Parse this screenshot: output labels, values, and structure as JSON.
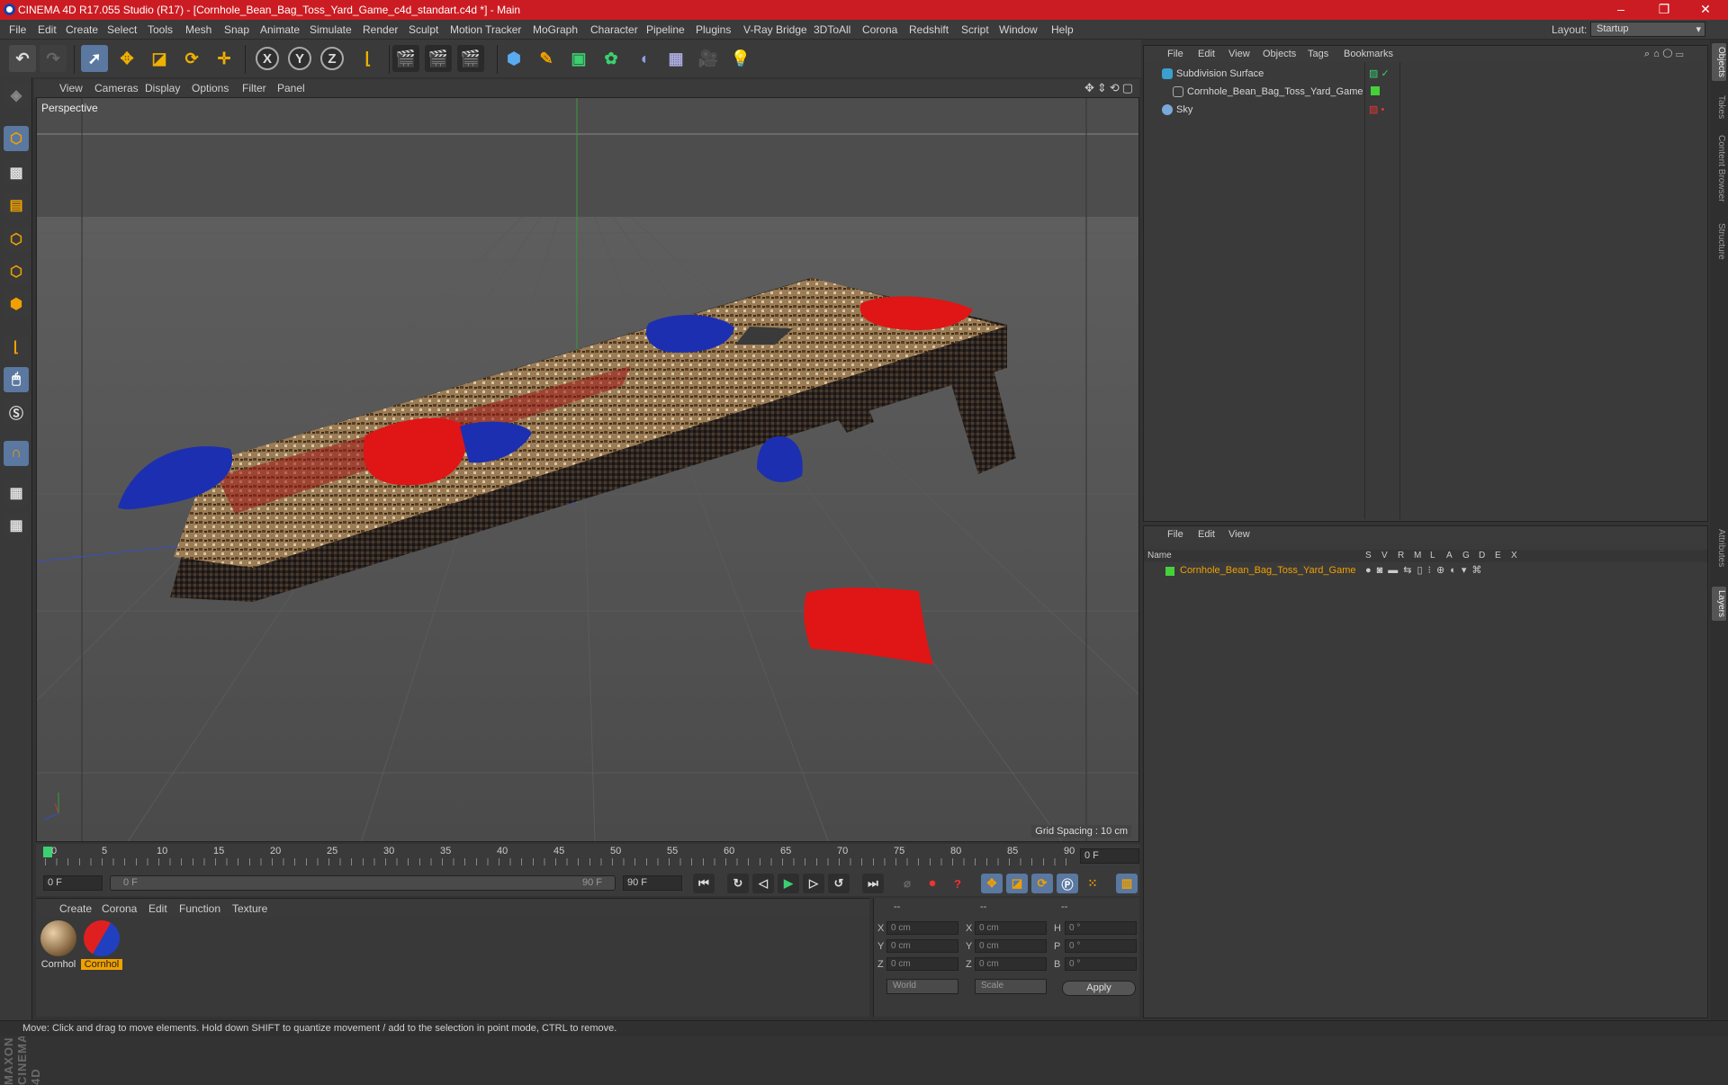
{
  "window": {
    "title": "CINEMA 4D R17.055 Studio (R17) - [Cornhole_Bean_Bag_Toss_Yard_Game_c4d_standart.c4d *] - Main",
    "minimize": "–",
    "maximize": "❐",
    "close": "✕"
  },
  "menu": [
    "File",
    "Edit",
    "Create",
    "Select",
    "Tools",
    "Mesh",
    "Snap",
    "Animate",
    "Simulate",
    "Render",
    "Sculpt",
    "Motion Tracker",
    "MoGraph",
    "Character",
    "Pipeline",
    "Plugins",
    "V-Ray Bridge",
    "3DToAll",
    "Corona",
    "Redshift",
    "Script",
    "Window",
    "Help"
  ],
  "layout": {
    "label": "Layout:",
    "value": "Startup"
  },
  "viewport": {
    "menu": [
      "View",
      "Cameras",
      "Display",
      "Options",
      "Filter",
      "Panel"
    ],
    "camera_label": "Perspective",
    "grid_spacing": "Grid Spacing : 10 cm"
  },
  "timeline": {
    "ticks": [
      "0",
      "5",
      "10",
      "15",
      "20",
      "25",
      "30",
      "35",
      "40",
      "45",
      "50",
      "55",
      "60",
      "65",
      "70",
      "75",
      "80",
      "85",
      "90"
    ],
    "current_frame": "0 F",
    "start_field": "0 F",
    "range_start": "0 F",
    "range_end": "90 F",
    "end_field": "90 F"
  },
  "materials": {
    "menu": [
      "Create",
      "Corona",
      "Edit",
      "Function",
      "Texture"
    ],
    "items": [
      {
        "label": "Cornhol",
        "selected": false
      },
      {
        "label": "Cornhol",
        "selected": true
      }
    ]
  },
  "coords": {
    "header": [
      "--",
      "--",
      "--"
    ],
    "rows": [
      {
        "a": "X",
        "av": "0 cm",
        "b": "X",
        "bv": "0 cm",
        "c": "H",
        "cv": "0 °"
      },
      {
        "a": "Y",
        "av": "0 cm",
        "b": "Y",
        "bv": "0 cm",
        "c": "P",
        "cv": "0 °"
      },
      {
        "a": "Z",
        "av": "0 cm",
        "b": "Z",
        "bv": "0 cm",
        "c": "B",
        "cv": "0 °"
      }
    ],
    "mode1": "World",
    "mode2": "Scale",
    "apply": "Apply"
  },
  "objects": {
    "menu": [
      "File",
      "Edit",
      "View",
      "Objects",
      "Tags",
      "Bookmarks"
    ],
    "items": [
      {
        "name": "Subdivision Surface",
        "color": "#3aa0d0"
      },
      {
        "name": "Cornhole_Bean_Bag_Toss_Yard_Game",
        "color": "#cccccc"
      },
      {
        "name": "Sky",
        "color": "#7aa8d8"
      }
    ]
  },
  "layers": {
    "menu": [
      "File",
      "Edit",
      "View"
    ],
    "columns": [
      "Name",
      "S",
      "V",
      "R",
      "M",
      "L",
      "A",
      "G",
      "D",
      "E",
      "X"
    ],
    "row": {
      "name": "Cornhole_Bean_Bag_Toss_Yard_Game",
      "color": "#44d13a"
    }
  },
  "right_tabs": [
    "Objects",
    "Takes",
    "Content Browser",
    "Structure",
    "Attributes",
    "Layers"
  ],
  "status": "Move: Click and drag to move elements. Hold down SHIFT to quantize movement / add to the selection in point mode, CTRL to remove.",
  "brand": "MAXON CINEMA 4D",
  "colors": {
    "title_bar": "#cc1c23",
    "accent_orange": "#f0a000",
    "selected_text": "#f0a000",
    "layer_green": "#44d13a"
  }
}
